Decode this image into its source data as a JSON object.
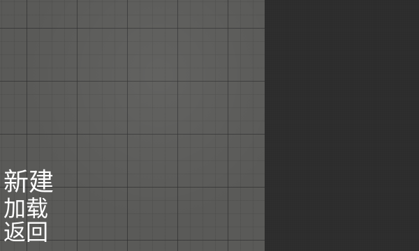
{
  "menu": {
    "items": [
      {
        "label": "新建"
      },
      {
        "label": "加载"
      },
      {
        "label": "返回"
      }
    ]
  },
  "colors": {
    "grid_background": "#5a5a58",
    "panel_background": "#2d2d2d",
    "menu_text": "#ffffff"
  }
}
